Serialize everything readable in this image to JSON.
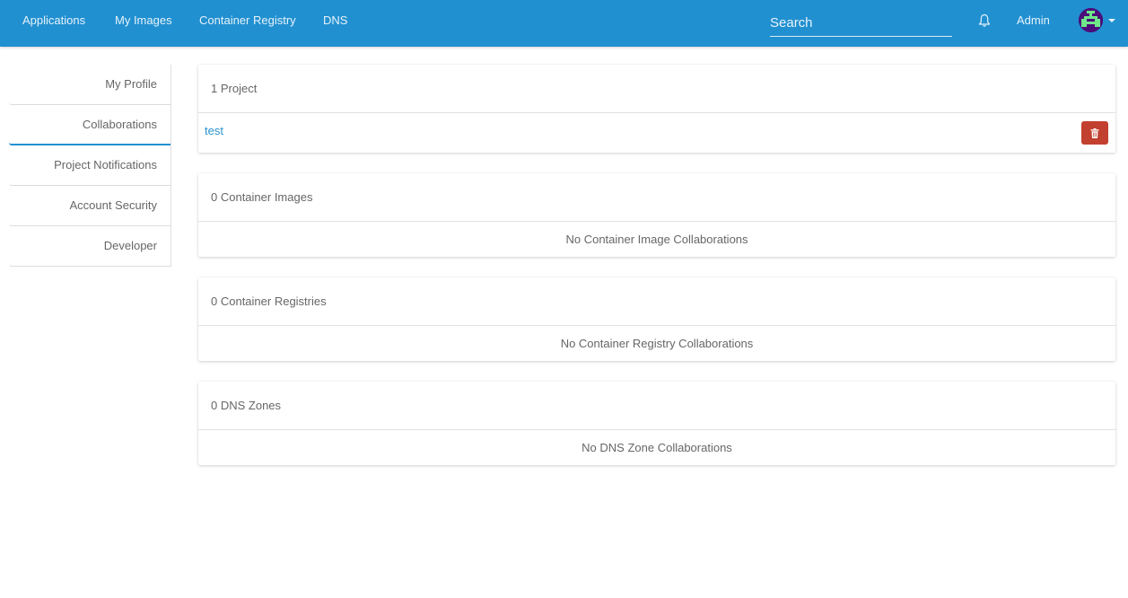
{
  "topbar": {
    "nav": [
      {
        "label": "Applications"
      },
      {
        "label": "My Images"
      },
      {
        "label": "Container Registry"
      },
      {
        "label": "DNS"
      }
    ],
    "search": {
      "placeholder": "Search",
      "value": ""
    },
    "notifications_icon": "bell-icon",
    "user_label": "Admin",
    "avatar_icon": "identicon-avatar",
    "menu_icon": "caret-down-icon",
    "colors": {
      "bar": "#2190d0",
      "avatar_bg": "#4b0d7a",
      "avatar_fg": "#6fe88a"
    }
  },
  "sidebar": {
    "items": [
      {
        "label": "My Profile",
        "active": false
      },
      {
        "label": "Collaborations",
        "active": true
      },
      {
        "label": "Project Notifications",
        "active": false
      },
      {
        "label": "Account Security",
        "active": false
      },
      {
        "label": "Developer",
        "active": false
      }
    ]
  },
  "sections": {
    "projects": {
      "title": "1 Project",
      "items": [
        {
          "name": "test",
          "delete_icon": "trash-icon"
        }
      ],
      "delete_color": "#c2402f"
    },
    "container_images": {
      "title": "0 Container Images",
      "empty": "No Container Image Collaborations"
    },
    "container_registries": {
      "title": "0 Container Registries",
      "empty": "No Container Registry Collaborations"
    },
    "dns_zones": {
      "title": "0 DNS Zones",
      "empty": "No DNS Zone Collaborations"
    }
  }
}
